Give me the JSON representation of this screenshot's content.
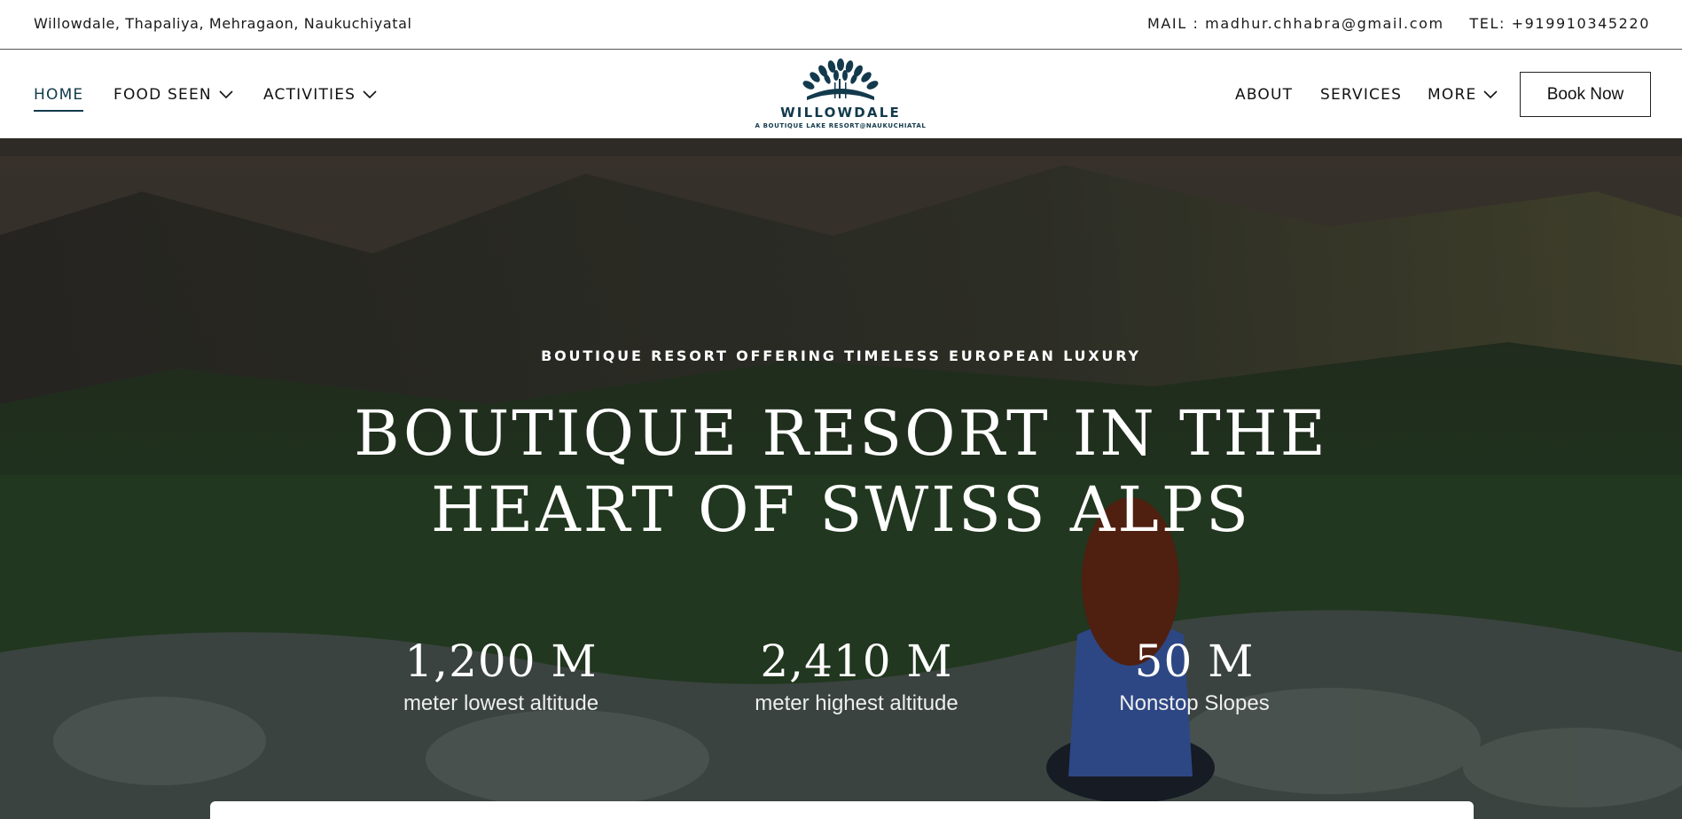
{
  "topbar": {
    "address": "Willowdale, Thapaliya, Mehragaon, Naukuchiyatal",
    "mail": "MAIL : madhur.chhabra@gmail.com",
    "tel": "TEL: +919910345220"
  },
  "nav": {
    "left": [
      {
        "label": "HOME",
        "active": true
      },
      {
        "label": "FOOD SEEN",
        "dropdown": true
      },
      {
        "label": "ACTIVITIES",
        "dropdown": true
      }
    ],
    "right": [
      {
        "label": "ABOUT"
      },
      {
        "label": "SERVICES"
      },
      {
        "label": "MORE",
        "dropdown": true
      }
    ],
    "book_label": "Book Now"
  },
  "logo": {
    "name": "WILLOWDALE",
    "tagline": "A BOUTIQUE LAKE RESORT@NAUKUCHIATAL",
    "icon": "tree-fan-icon"
  },
  "hero": {
    "kicker": "BOUTIQUE RESORT OFFERING TIMELESS EUROPEAN LUXURY",
    "title_line1": "BOUTIQUE RESORT IN THE",
    "title_line2": "HEART OF SWISS ALPS",
    "stats": [
      {
        "value": "1,200 M",
        "label": "meter lowest altitude"
      },
      {
        "value": "2,410 M",
        "label": "meter highest altitude"
      },
      {
        "value": "50 M",
        "label": "Nonstop Slopes"
      }
    ]
  },
  "colors": {
    "brand": "#123a4c",
    "hero_text": "#ffffff"
  }
}
